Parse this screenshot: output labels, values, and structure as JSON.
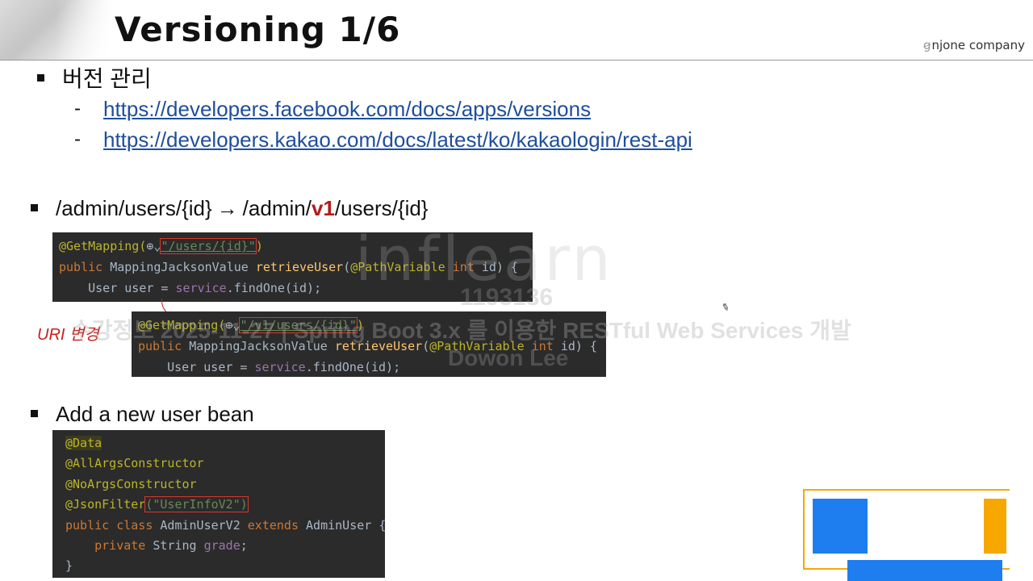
{
  "slide": {
    "title": "Versioning 1/6",
    "brand": "njone company",
    "brand_mark": "ꞡ"
  },
  "section1": {
    "heading": "버전 관리",
    "links": [
      "https://developers.facebook.com/docs/apps/versions",
      "https://developers.kakao.com/docs/latest/ko/kakaologin/rest-api"
    ],
    "dash": "-"
  },
  "section2": {
    "prefix": "/admin/users/{id}",
    "arrow": "→",
    "mid": "/admin/",
    "v1": "v1",
    "suffix": "/users/{id}",
    "uri_label": "URI 변경",
    "code_before": {
      "l1_ann": "@GetMapping(",
      "l1_icon": "⊕⌄",
      "l1_str": "\"/users/{id}\"",
      "l1_end": ")",
      "l2_kw": "public ",
      "l2_type": "MappingJacksonValue ",
      "l2_fn": "retrieveUser",
      "l2_open": "(",
      "l2_ann": "@PathVariable ",
      "l2_kw2": "int ",
      "l2_rest": "id) {",
      "l3_indent": "    User user = ",
      "l3_fld": "service",
      "l3_rest": ".findOne(id);"
    },
    "code_after": {
      "l1_ann": "@GetMapping(",
      "l1_icon": "⊕⌄",
      "l1_str": "\"/v1/users/{id}\"",
      "l1_end": ")",
      "l2_kw": "public ",
      "l2_type": "MappingJacksonValue ",
      "l2_fn": "retrieveUser",
      "l2_open": "(",
      "l2_ann": "@PathVariable ",
      "l2_kw2": "int ",
      "l2_rest": "id) {",
      "l3_indent": "    User user = ",
      "l3_fld": "service",
      "l3_rest": ".findOne(id);"
    }
  },
  "section3": {
    "heading": "Add a new user bean",
    "code": {
      "l1": "@Data",
      "l2": "@AllArgsConstructor",
      "l3": "@NoArgsConstructor",
      "l4_ann": "@JsonFilter",
      "l4_str": "(\"UserInfoV2\")",
      "l5_kw": "public class ",
      "l5_name": "AdminUserV2 ",
      "l5_kw2": "extends ",
      "l5_rest": "AdminUser {",
      "l6_kw": "    private ",
      "l6_type": "String ",
      "l6_fld": "grade",
      "l6_end": ";",
      "l7": "}"
    }
  },
  "watermark": {
    "logo": "inflearn",
    "id": "1193136",
    "course": "수강정보 2025-11-27 | Spring Boot 3.x 를 이용한 RESTful Web Services 개발",
    "name": "Dowon Lee"
  },
  "colors": {
    "link": "#1f4e9c",
    "accent_red": "#b31b1b",
    "code_bg": "#2b2b2b",
    "corner_blue": "#1e7ef0",
    "corner_orange": "#f6a800"
  }
}
